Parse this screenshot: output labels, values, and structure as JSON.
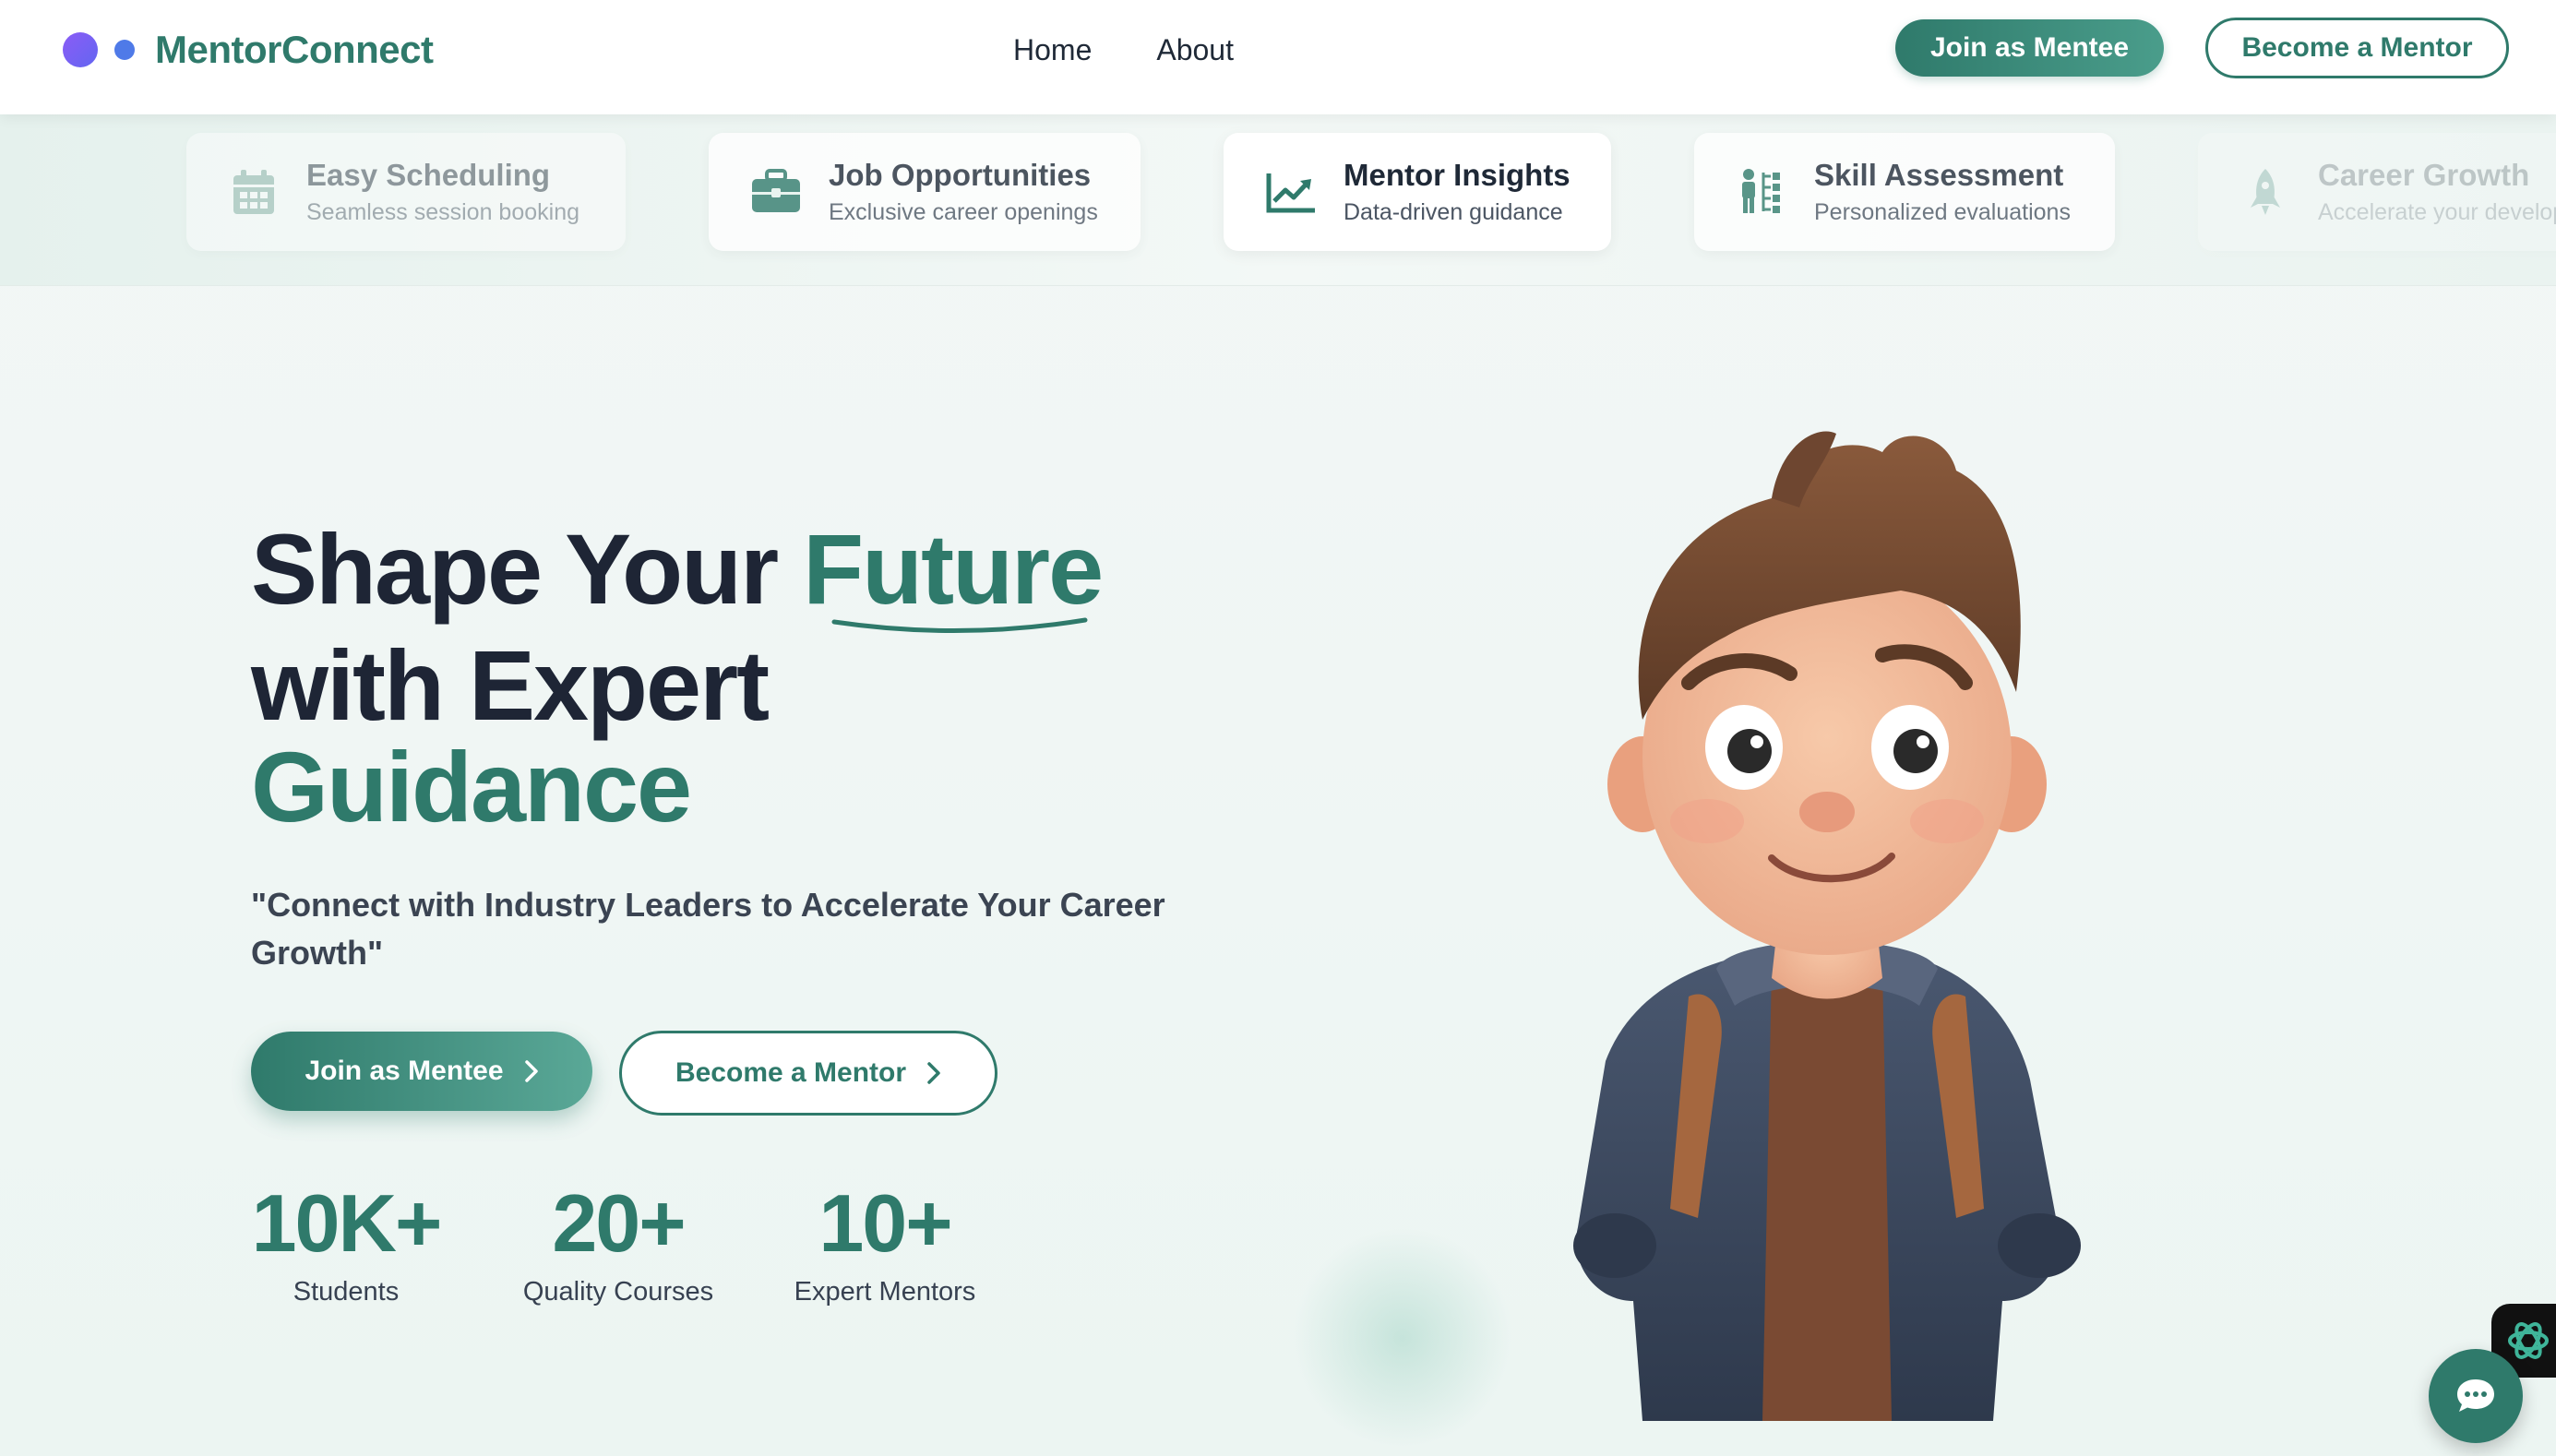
{
  "brand": {
    "name": "MentorConnect"
  },
  "nav": {
    "links": [
      "Home",
      "About"
    ],
    "join_label": "Join as Mentee",
    "mentor_label": "Become a Mentor"
  },
  "features": [
    {
      "title": "Easy Scheduling",
      "subtitle": "Seamless session booking",
      "icon": "calendar-icon"
    },
    {
      "title": "Job Opportunities",
      "subtitle": "Exclusive career openings",
      "icon": "briefcase-icon"
    },
    {
      "title": "Mentor Insights",
      "subtitle": "Data-driven guidance",
      "icon": "chart-line-icon"
    },
    {
      "title": "Skill Assessment",
      "subtitle": "Personalized evaluations",
      "icon": "skill-tree-icon"
    },
    {
      "title": "Career Growth",
      "subtitle": "Accelerate your development",
      "icon": "rocket-icon"
    }
  ],
  "hero": {
    "title_part1": "Shape Your ",
    "title_accent1": "Future",
    "title_line2": "with Expert",
    "title_accent2": "Guidance",
    "tagline": "\"Connect with Industry Leaders to Accelerate Your Career Growth\"",
    "primary_cta": "Join as Mentee",
    "secondary_cta": "Become a Mentor"
  },
  "stats": [
    {
      "value": "10K+",
      "label": "Students"
    },
    {
      "value": "20+",
      "label": "Quality Courses"
    },
    {
      "value": "10+",
      "label": "Expert Mentors"
    }
  ],
  "colors": {
    "accent": "#2f7a6b",
    "heading": "#1e2535",
    "logo_gradient": "#8b5cf6",
    "logo_dot": "#4f7ae8"
  }
}
